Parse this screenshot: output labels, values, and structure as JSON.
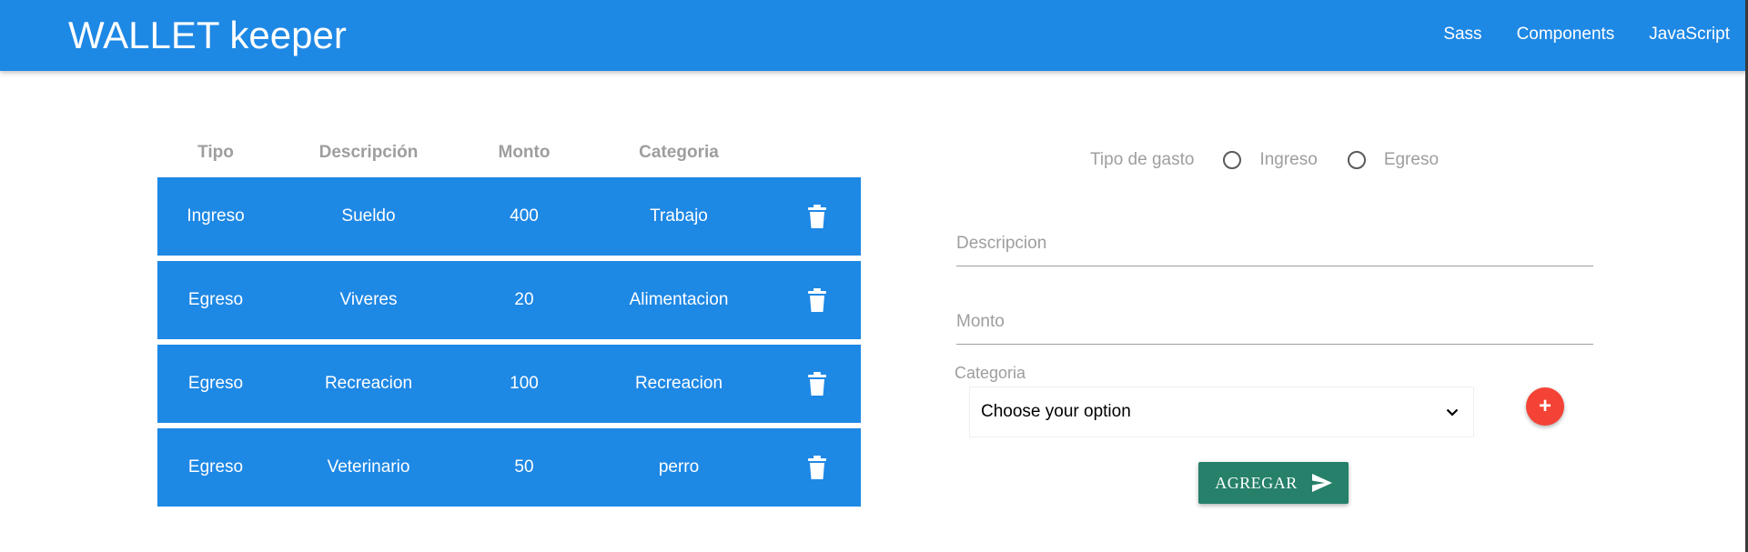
{
  "navbar": {
    "brand": "WALLET keeper",
    "links": [
      "Sass",
      "Components",
      "JavaScript"
    ]
  },
  "table": {
    "headers": [
      "Tipo",
      "Descripción",
      "Monto",
      "Categoria"
    ],
    "rows": [
      {
        "tipo": "Ingreso",
        "descripcion": "Sueldo",
        "monto": "400",
        "categoria": "Trabajo"
      },
      {
        "tipo": "Egreso",
        "descripcion": "Viveres",
        "monto": "20",
        "categoria": "Alimentacion"
      },
      {
        "tipo": "Egreso",
        "descripcion": "Recreacion",
        "monto": "100",
        "categoria": "Recreacion"
      },
      {
        "tipo": "Egreso",
        "descripcion": "Veterinario",
        "monto": "50",
        "categoria": "perro"
      }
    ],
    "delete_icon": "trash-icon"
  },
  "form": {
    "tipo_legend": "Tipo de gasto",
    "tipo_options": [
      "Ingreso",
      "Egreso"
    ],
    "descripcion_placeholder": "Descripcion",
    "monto_placeholder": "Monto",
    "categoria_label": "Categoria",
    "categoria_selected": "Choose your option",
    "add_category_icon": "plus-icon",
    "submit_label": "AGREGAR",
    "submit_icon": "send-icon"
  },
  "colors": {
    "primary": "#1e88e5",
    "fab": "#f44336",
    "submit": "#26806a",
    "muted_text": "#9e9e9e"
  }
}
